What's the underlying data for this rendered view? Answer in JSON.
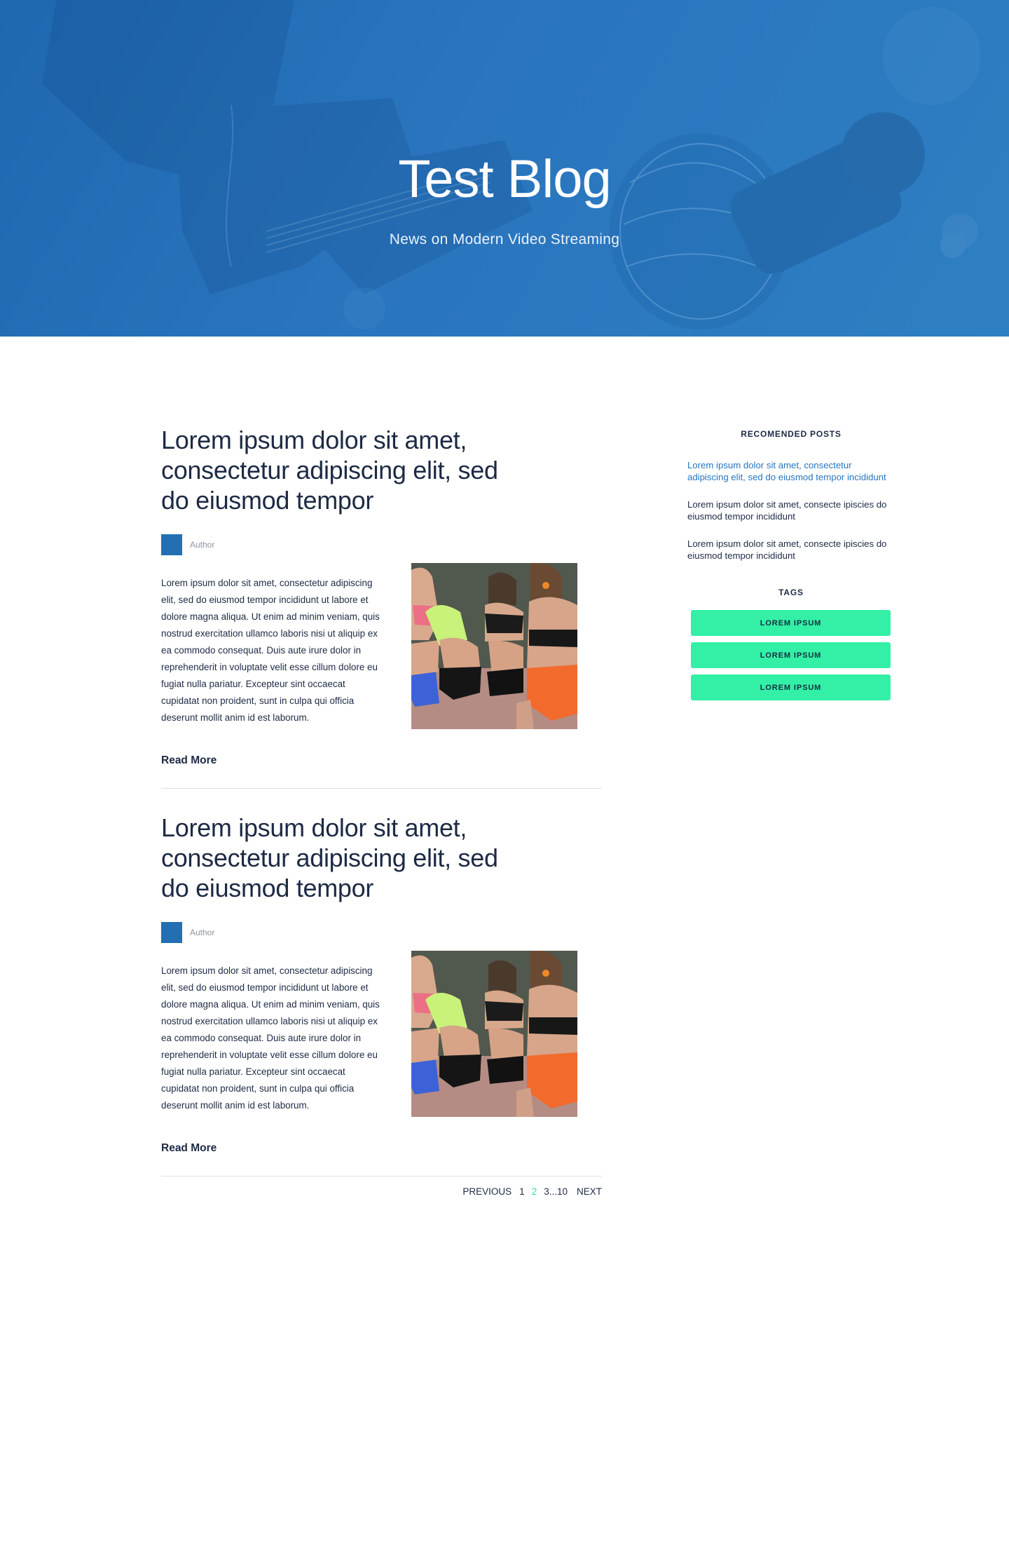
{
  "hero": {
    "title": "Test Blog",
    "subtitle": "News on Modern Video Streaming"
  },
  "posts": [
    {
      "title": "Lorem ipsum dolor sit amet, consectetur adipiscing elit, sed do eiusmod tempor",
      "author": "Author",
      "excerpt": "Lorem ipsum dolor sit amet, consectetur adipiscing elit, sed do eiusmod tempor incididunt ut labore et dolore magna aliqua. Ut enim ad minim veniam, quis nostrud exercitation ullamco laboris nisi ut aliquip ex ea commodo consequat. Duis aute irure dolor in reprehenderit in voluptate velit esse cillum dolore eu fugiat nulla pariatur. Excepteur sint occaecat cupidatat non proident, sunt in culpa qui officia deserunt mollit anim id est laborum.",
      "read_more": "Read More"
    },
    {
      "title": "Lorem ipsum dolor sit amet, consectetur adipiscing elit, sed do eiusmod tempor",
      "author": "Author",
      "excerpt": "Lorem ipsum dolor sit amet, consectetur adipiscing elit, sed do eiusmod tempor incididunt ut labore et dolore magna aliqua. Ut enim ad minim veniam, quis nostrud exercitation ullamco laboris nisi ut aliquip ex ea commodo consequat. Duis aute irure dolor in reprehenderit in voluptate velit esse cillum dolore eu fugiat nulla pariatur. Excepteur sint occaecat cupidatat non proident, sunt in culpa qui officia deserunt mollit anim id est laborum.",
      "read_more": "Read More"
    }
  ],
  "pagination": {
    "previous": "PREVIOUS",
    "page_1": "1",
    "page_2": "2",
    "page_range": "3...10",
    "next": "NEXT",
    "current_page": 2
  },
  "sidebar": {
    "recommended_heading": "RECOMENDED POSTS",
    "recommended": [
      "Lorem ipsum dolor sit amet, consectetur adipiscing elit, sed do eiusmod tempor incididunt",
      "Lorem ipsum dolor sit amet, consecte ipiscies do eiusmod tempor incididunt",
      "Lorem ipsum dolor sit amet, consecte ipiscies do eiusmod tempor incididunt"
    ],
    "tags_heading": "TAGS",
    "tags": [
      "LOREM IPSUM",
      "LOREM IPSUM",
      "LOREM IPSUM"
    ]
  },
  "colors": {
    "hero_blue": "#2270b2",
    "link_blue": "#2675c0",
    "accent_green": "#33f0a6",
    "text_dark": "#1d2a44"
  }
}
